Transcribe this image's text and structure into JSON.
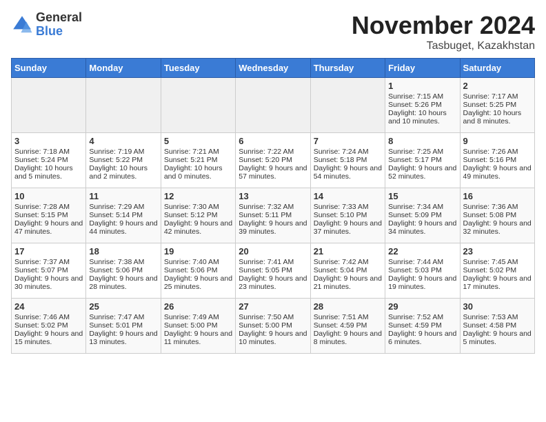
{
  "header": {
    "logo_general": "General",
    "logo_blue": "Blue",
    "month": "November 2024",
    "location": "Tasbuget, Kazakhstan"
  },
  "days_of_week": [
    "Sunday",
    "Monday",
    "Tuesday",
    "Wednesday",
    "Thursday",
    "Friday",
    "Saturday"
  ],
  "weeks": [
    [
      {
        "day": "",
        "info": ""
      },
      {
        "day": "",
        "info": ""
      },
      {
        "day": "",
        "info": ""
      },
      {
        "day": "",
        "info": ""
      },
      {
        "day": "",
        "info": ""
      },
      {
        "day": "1",
        "info": "Sunrise: 7:15 AM\nSunset: 5:26 PM\nDaylight: 10 hours and 10 minutes."
      },
      {
        "day": "2",
        "info": "Sunrise: 7:17 AM\nSunset: 5:25 PM\nDaylight: 10 hours and 8 minutes."
      }
    ],
    [
      {
        "day": "3",
        "info": "Sunrise: 7:18 AM\nSunset: 5:24 PM\nDaylight: 10 hours and 5 minutes."
      },
      {
        "day": "4",
        "info": "Sunrise: 7:19 AM\nSunset: 5:22 PM\nDaylight: 10 hours and 2 minutes."
      },
      {
        "day": "5",
        "info": "Sunrise: 7:21 AM\nSunset: 5:21 PM\nDaylight: 10 hours and 0 minutes."
      },
      {
        "day": "6",
        "info": "Sunrise: 7:22 AM\nSunset: 5:20 PM\nDaylight: 9 hours and 57 minutes."
      },
      {
        "day": "7",
        "info": "Sunrise: 7:24 AM\nSunset: 5:18 PM\nDaylight: 9 hours and 54 minutes."
      },
      {
        "day": "8",
        "info": "Sunrise: 7:25 AM\nSunset: 5:17 PM\nDaylight: 9 hours and 52 minutes."
      },
      {
        "day": "9",
        "info": "Sunrise: 7:26 AM\nSunset: 5:16 PM\nDaylight: 9 hours and 49 minutes."
      }
    ],
    [
      {
        "day": "10",
        "info": "Sunrise: 7:28 AM\nSunset: 5:15 PM\nDaylight: 9 hours and 47 minutes."
      },
      {
        "day": "11",
        "info": "Sunrise: 7:29 AM\nSunset: 5:14 PM\nDaylight: 9 hours and 44 minutes."
      },
      {
        "day": "12",
        "info": "Sunrise: 7:30 AM\nSunset: 5:12 PM\nDaylight: 9 hours and 42 minutes."
      },
      {
        "day": "13",
        "info": "Sunrise: 7:32 AM\nSunset: 5:11 PM\nDaylight: 9 hours and 39 minutes."
      },
      {
        "day": "14",
        "info": "Sunrise: 7:33 AM\nSunset: 5:10 PM\nDaylight: 9 hours and 37 minutes."
      },
      {
        "day": "15",
        "info": "Sunrise: 7:34 AM\nSunset: 5:09 PM\nDaylight: 9 hours and 34 minutes."
      },
      {
        "day": "16",
        "info": "Sunrise: 7:36 AM\nSunset: 5:08 PM\nDaylight: 9 hours and 32 minutes."
      }
    ],
    [
      {
        "day": "17",
        "info": "Sunrise: 7:37 AM\nSunset: 5:07 PM\nDaylight: 9 hours and 30 minutes."
      },
      {
        "day": "18",
        "info": "Sunrise: 7:38 AM\nSunset: 5:06 PM\nDaylight: 9 hours and 28 minutes."
      },
      {
        "day": "19",
        "info": "Sunrise: 7:40 AM\nSunset: 5:06 PM\nDaylight: 9 hours and 25 minutes."
      },
      {
        "day": "20",
        "info": "Sunrise: 7:41 AM\nSunset: 5:05 PM\nDaylight: 9 hours and 23 minutes."
      },
      {
        "day": "21",
        "info": "Sunrise: 7:42 AM\nSunset: 5:04 PM\nDaylight: 9 hours and 21 minutes."
      },
      {
        "day": "22",
        "info": "Sunrise: 7:44 AM\nSunset: 5:03 PM\nDaylight: 9 hours and 19 minutes."
      },
      {
        "day": "23",
        "info": "Sunrise: 7:45 AM\nSunset: 5:02 PM\nDaylight: 9 hours and 17 minutes."
      }
    ],
    [
      {
        "day": "24",
        "info": "Sunrise: 7:46 AM\nSunset: 5:02 PM\nDaylight: 9 hours and 15 minutes."
      },
      {
        "day": "25",
        "info": "Sunrise: 7:47 AM\nSunset: 5:01 PM\nDaylight: 9 hours and 13 minutes."
      },
      {
        "day": "26",
        "info": "Sunrise: 7:49 AM\nSunset: 5:00 PM\nDaylight: 9 hours and 11 minutes."
      },
      {
        "day": "27",
        "info": "Sunrise: 7:50 AM\nSunset: 5:00 PM\nDaylight: 9 hours and 10 minutes."
      },
      {
        "day": "28",
        "info": "Sunrise: 7:51 AM\nSunset: 4:59 PM\nDaylight: 9 hours and 8 minutes."
      },
      {
        "day": "29",
        "info": "Sunrise: 7:52 AM\nSunset: 4:59 PM\nDaylight: 9 hours and 6 minutes."
      },
      {
        "day": "30",
        "info": "Sunrise: 7:53 AM\nSunset: 4:58 PM\nDaylight: 9 hours and 5 minutes."
      }
    ]
  ]
}
